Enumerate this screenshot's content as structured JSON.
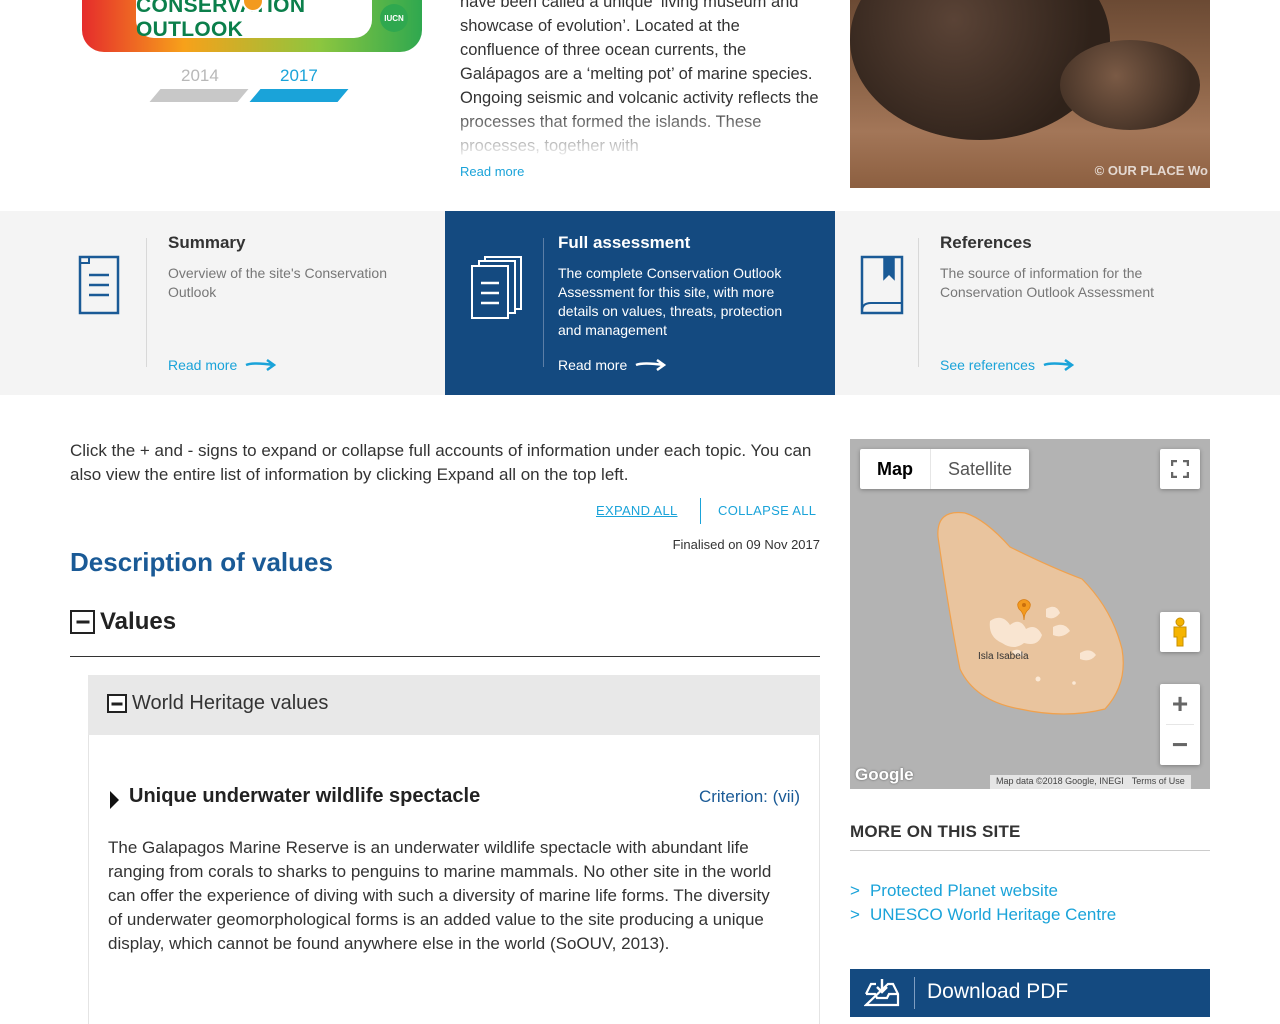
{
  "badge": {
    "letter": "C",
    "title": "CONSERVATION OUTLOOK",
    "logo_text": "IUCN"
  },
  "years": {
    "previous": "2014",
    "current": "2017"
  },
  "intro": {
    "text": "have been called a unique ‘living museum and showcase of evolution’. Located at the confluence of three ocean currents, the Galápagos are a ‘melting pot’ of marine species. Ongoing seismic and volcanic activity reflects the processes that formed the islands. These processes, together with",
    "read_more": "Read more"
  },
  "photo": {
    "credit": "© OUR PLACE Wo"
  },
  "panels": [
    {
      "title": "Summary",
      "desc": "Overview of the site's Conservation Outlook",
      "link": "Read more"
    },
    {
      "title": "Full assessment",
      "desc": "The complete Conservation Outlook Assessment for this site, with more details on values, threats, protection and management",
      "link": "Read more"
    },
    {
      "title": "References",
      "desc": "The source of information for the Conservation Outlook Assessment",
      "link": "See references"
    }
  ],
  "main": {
    "help_text": "Click the + and - signs to expand or collapse full accounts of information under each topic. You can also view the entire list of information by clicking Expand all on the top left.",
    "expand_all": "EXPAND ALL",
    "collapse_all": "COLLAPSE ALL",
    "finalised": "Finalised on 09 Nov 2017",
    "section_title": "Description of values",
    "values_title": "Values",
    "whv_title": "World Heritage values",
    "value_item": {
      "title": "Unique underwater wildlife spectacle",
      "criterion": "Criterion: (vii)",
      "body": "The Galapagos Marine Reserve is an underwater wildlife spectacle with abundant life ranging from corals to sharks to penguins to marine mammals. No other site in the world can offer the experience of diving with such a diversity of marine life forms. The diversity of underwater geomorphological forms is an added value to the site producing a unique display, which cannot be found anywhere else in the world (SoOUV, 2013)."
    }
  },
  "map": {
    "type_map": "Map",
    "type_satellite": "Satellite",
    "island_label": "Isla Isabela",
    "google": "Google",
    "attribution": "Map data ©2018 Google, INEGI",
    "terms": "Terms of Use",
    "zoom_in": "+",
    "zoom_out": "−",
    "colors": {
      "area_fill": "#f2c79a",
      "area_stroke": "#f0a14d",
      "marker": "#f39a1e"
    }
  },
  "sidebar": {
    "more_title": "MORE ON THIS SITE",
    "links": [
      {
        "marker": ">",
        "label": "Protected Planet website"
      },
      {
        "marker": ">",
        "label": "UNESCO World Heritage Centre"
      }
    ],
    "download": "Download PDF"
  },
  "colors": {
    "accent": "#1aa3d9",
    "navy": "#144a80",
    "heading": "#1a5a96"
  }
}
